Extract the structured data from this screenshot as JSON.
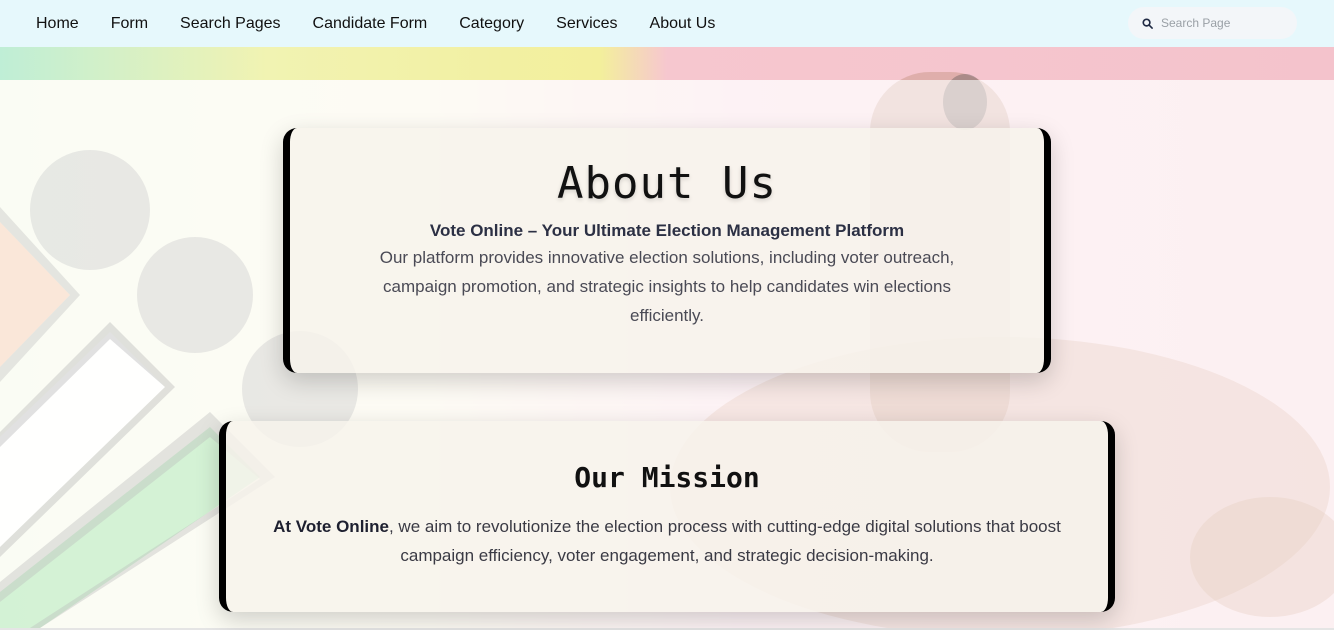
{
  "nav": {
    "items": [
      "Home",
      "Form",
      "Search Pages",
      "Candidate Form",
      "Category",
      "Services",
      "About Us"
    ],
    "search_placeholder": "Search Page"
  },
  "about": {
    "title": "About Us",
    "subtitle": "Vote Online – Your Ultimate Election Management Platform",
    "description": "Our platform provides innovative election solutions, including voter outreach, campaign promotion, and strategic insights to help candidates win elections efficiently."
  },
  "mission": {
    "title": "Our Mission",
    "lead": "At Vote Online",
    "text": ", we aim to revolutionize the election process with cutting-edge digital solutions that boost campaign efficiency, voter engagement, and strategic decision-making."
  },
  "colors": {
    "nav_bg": "#e6f8fc",
    "card_border": "#000000",
    "title_text": "#111111",
    "subtitle_text": "#2c3044"
  },
  "icons": {
    "search": "search-icon"
  }
}
